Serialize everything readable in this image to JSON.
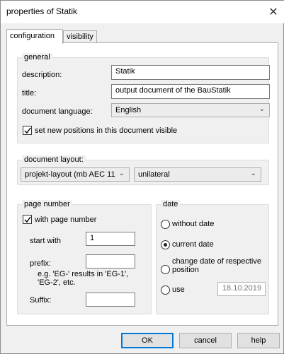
{
  "window": {
    "title": "properties of Statik",
    "close_glyph": "✕"
  },
  "tabs": [
    {
      "label": "configuration"
    },
    {
      "label": "visibility"
    }
  ],
  "general": {
    "legend": "general",
    "description_label": "description:",
    "description_value": "Statik",
    "title_label": "title:",
    "title_value": "output document of the BauStatik",
    "language_label": "document language:",
    "language_value": "English",
    "visible_label": "set new positions in this document visible",
    "visible_checked": true
  },
  "layout": {
    "legend": "document layout:",
    "layout_value": "projekt-layout (mb AEC 11",
    "sides_value": "unilateral"
  },
  "page_number": {
    "legend": "page number",
    "with_label": "with page number",
    "with_checked": true,
    "start_label": "start with",
    "start_value": "1",
    "prefix_label": "prefix:",
    "prefix_value": "",
    "hint": "e.g. 'EG-' results in 'EG-1', 'EG-2',  etc.",
    "suffix_label": "Suffix:",
    "suffix_value": ""
  },
  "date": {
    "legend": "date",
    "options": [
      {
        "label": "without date",
        "selected": false
      },
      {
        "label": "current date",
        "selected": true
      },
      {
        "label": "change date of respective position",
        "selected": false
      },
      {
        "label": "use",
        "selected": false
      }
    ],
    "use_value": "18.10.2019"
  },
  "buttons": {
    "ok": "OK",
    "cancel": "cancel",
    "help": "help"
  },
  "icons": {
    "dropdown": "chevron-down-icon",
    "close": "close-icon",
    "check": "check-icon"
  }
}
